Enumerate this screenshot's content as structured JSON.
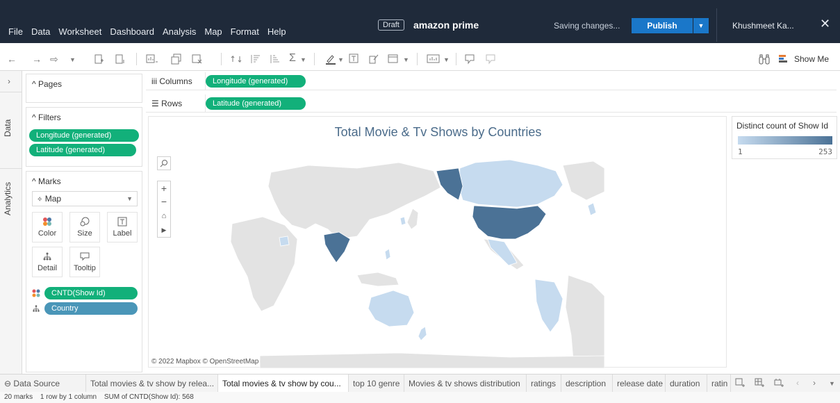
{
  "app": {
    "menu": [
      "File",
      "Data",
      "Worksheet",
      "Dashboard",
      "Analysis",
      "Map",
      "Format",
      "Help"
    ],
    "draft_label": "Draft",
    "workbook_title": "amazon prime",
    "saving_text": "Saving changes...",
    "publish_label": "Publish",
    "user_name": "Khushmeet Ka..."
  },
  "toolbar": {
    "show_me_label": "Show Me"
  },
  "side_tabs": {
    "data_label": "Data",
    "analytics_label": "Analytics"
  },
  "pages": {
    "title": "Pages"
  },
  "filters": {
    "title": "Filters",
    "items": [
      "Longitude (generated)",
      "Latitude (generated)"
    ]
  },
  "marks": {
    "title": "Marks",
    "type": "Map",
    "cards": [
      "Color",
      "Size",
      "Label",
      "Detail",
      "Tooltip"
    ],
    "fields": [
      "CNTD(Show Id)",
      "Country"
    ]
  },
  "shelves": {
    "columns_label": "Columns",
    "columns_pill": "Longitude (generated)",
    "rows_label": "Rows",
    "rows_pill": "Latitude (generated)"
  },
  "view": {
    "title": "Total Movie & Tv Shows by Countries",
    "attribution": "© 2022 Mapbox © OpenStreetMap"
  },
  "legend": {
    "title": "Distinct count of Show Id",
    "min": "1",
    "max": "253",
    "color_low": "#c6dbef",
    "color_high": "#4b7296"
  },
  "sheet_tabs": {
    "data_source": "Data Source",
    "tabs": [
      "Total movies & tv show by relea...",
      "Total movies & tv show by cou...",
      "top 10 genre",
      "Movies & tv shows distribution",
      "ratings",
      "description",
      "release date",
      "duration",
      "ratin"
    ],
    "active_index": 1
  },
  "status": {
    "marks": "20 marks",
    "grid": "1 row by 1 column",
    "sum": "SUM of CNTD(Show Id): 568"
  }
}
